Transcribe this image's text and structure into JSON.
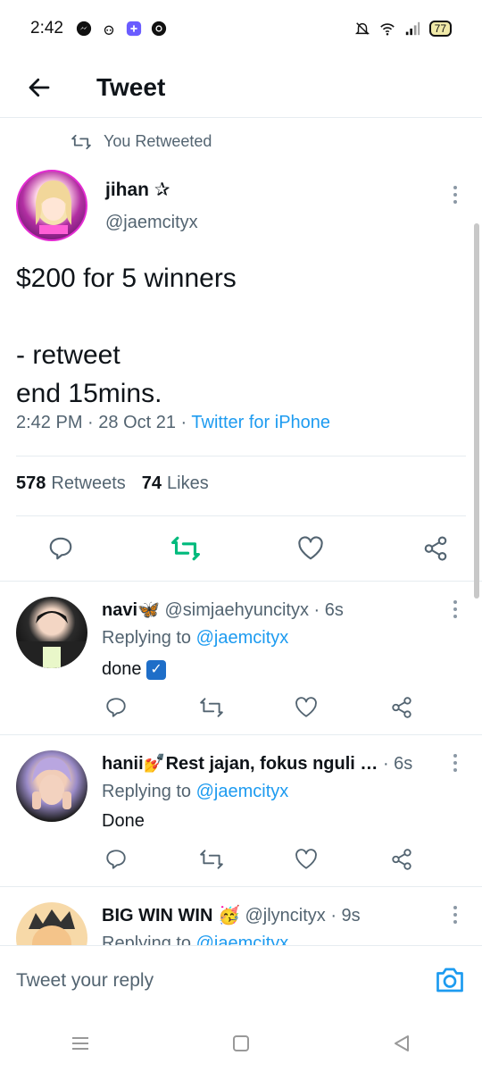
{
  "status_bar": {
    "time": "2:42",
    "battery": "77"
  },
  "header": {
    "title": "Tweet"
  },
  "retweet_context": "You Retweeted",
  "tweet": {
    "author_name": "jihan ✰",
    "author_handle": "@jaemcityx",
    "text": "$200 for 5 winners\n\n- retweet\nend 15mins.",
    "time": "2:42 PM",
    "date": "28 Oct 21",
    "source": "Twitter for iPhone",
    "retweet_count": "578",
    "retweet_label": "Retweets",
    "like_count": "74",
    "like_label": "Likes"
  },
  "replies": [
    {
      "name": "navi🦋",
      "handle": "@simjaehyuncityx",
      "time": "6s",
      "replying_label": "Replying to",
      "replying_to": "@jaemcityx",
      "text": "done",
      "emoji": "✓"
    },
    {
      "name": "hanii💅Rest jajan, fokus nguli …",
      "handle": "",
      "time": "6s",
      "replying_label": "Replying to",
      "replying_to": "@jaemcityx",
      "text": "Done"
    },
    {
      "name": "BIG WIN WIN 🥳",
      "handle": "@jlyncityx",
      "time": "9s",
      "replying_label": "Replying to",
      "replying_to": "@jaemcityx",
      "text": ""
    }
  ],
  "reply_bar": {
    "placeholder": "Tweet your reply"
  },
  "colors": {
    "accent": "#1d9bf0",
    "retweet_green": "#00ba7c",
    "secondary_text": "#536471"
  },
  "icons": {
    "back": "arrow-left-icon",
    "retweet": "retweet-icon",
    "reply": "reply-icon",
    "like": "heart-icon",
    "share": "share-icon",
    "more": "more-vertical-icon",
    "camera": "camera-icon"
  }
}
